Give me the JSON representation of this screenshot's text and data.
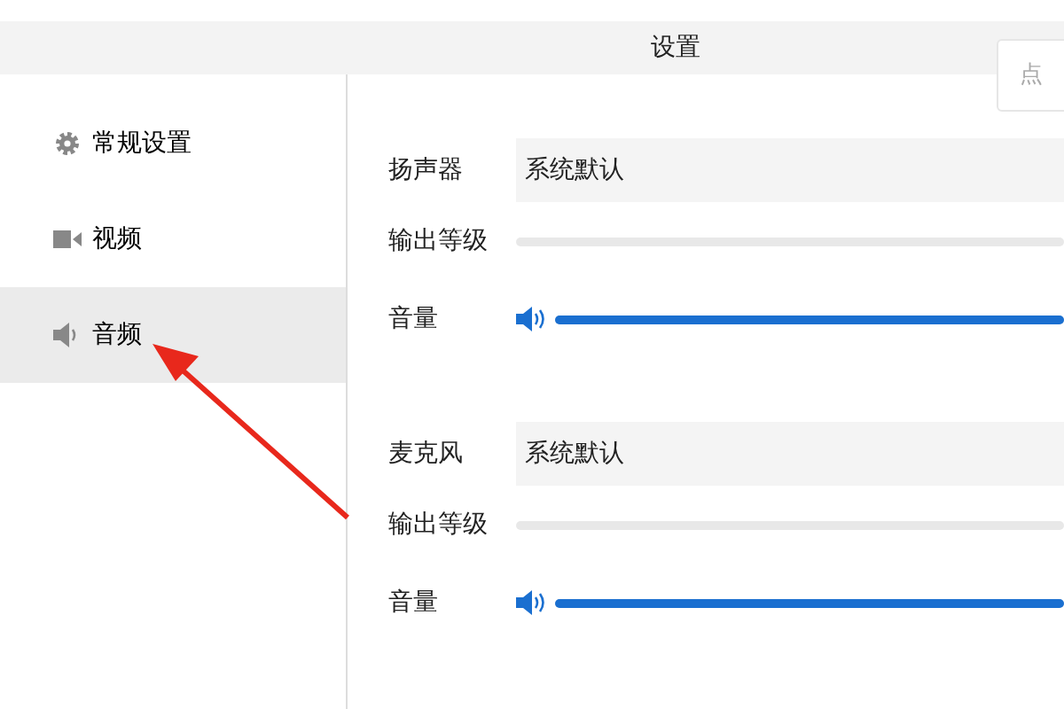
{
  "window": {
    "title": "设置"
  },
  "header_button": {
    "label": "点"
  },
  "sidebar": {
    "items": [
      {
        "label": "常规设置",
        "kind": "gear",
        "selected": false
      },
      {
        "label": "视频",
        "kind": "camera",
        "selected": false
      },
      {
        "label": "音频",
        "kind": "speaker",
        "selected": true
      }
    ]
  },
  "sections": [
    {
      "device_label": "扬声器",
      "device_value": "系统默认",
      "output_label": "输出等级",
      "output_meter": {
        "level": 0
      },
      "volume_label": "音量",
      "volume": {
        "level": 1
      }
    },
    {
      "device_label": "麦克风",
      "device_value": "系统默认",
      "output_label": "输出等级",
      "output_meter": {
        "level": 0
      },
      "volume_label": "音量",
      "volume": {
        "level": 1
      }
    }
  ]
}
